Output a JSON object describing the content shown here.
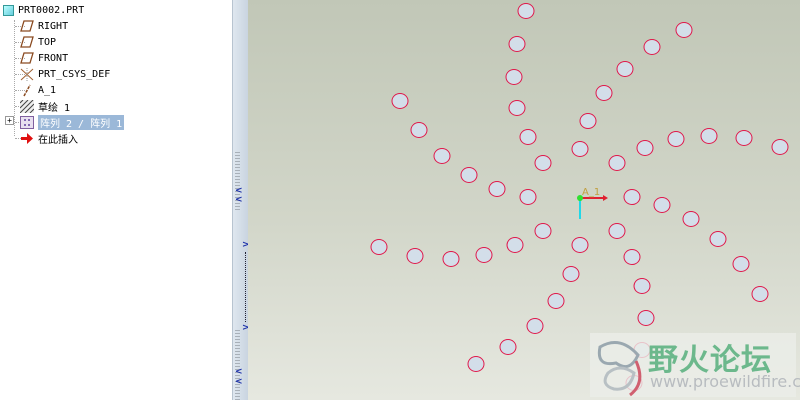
{
  "model_tree": {
    "root": {
      "label": "PRT0002.PRT",
      "icon": "part-icon"
    },
    "items": [
      {
        "label": "RIGHT",
        "icon": "datum-plane-icon"
      },
      {
        "label": "TOP",
        "icon": "datum-plane-icon"
      },
      {
        "label": "FRONT",
        "icon": "datum-plane-icon"
      },
      {
        "label": "PRT_CSYS_DEF",
        "icon": "coordinate-system-icon"
      },
      {
        "label": "A_1",
        "icon": "datum-axis-icon"
      },
      {
        "label": "草绘 1",
        "icon": "sketch-icon"
      },
      {
        "label": "阵列 2 / 阵列 1",
        "icon": "pattern-icon",
        "selected": true,
        "expandable": true
      },
      {
        "label": "在此插入",
        "icon": "insert-here-arrow-icon"
      }
    ]
  },
  "viewport": {
    "axis_label": "A_1",
    "circle_stroke": "#e0184a",
    "circle_fill": "#d3dee9"
  },
  "watermark": {
    "title": "野火论坛",
    "url": "www.proewildfire.cn"
  }
}
